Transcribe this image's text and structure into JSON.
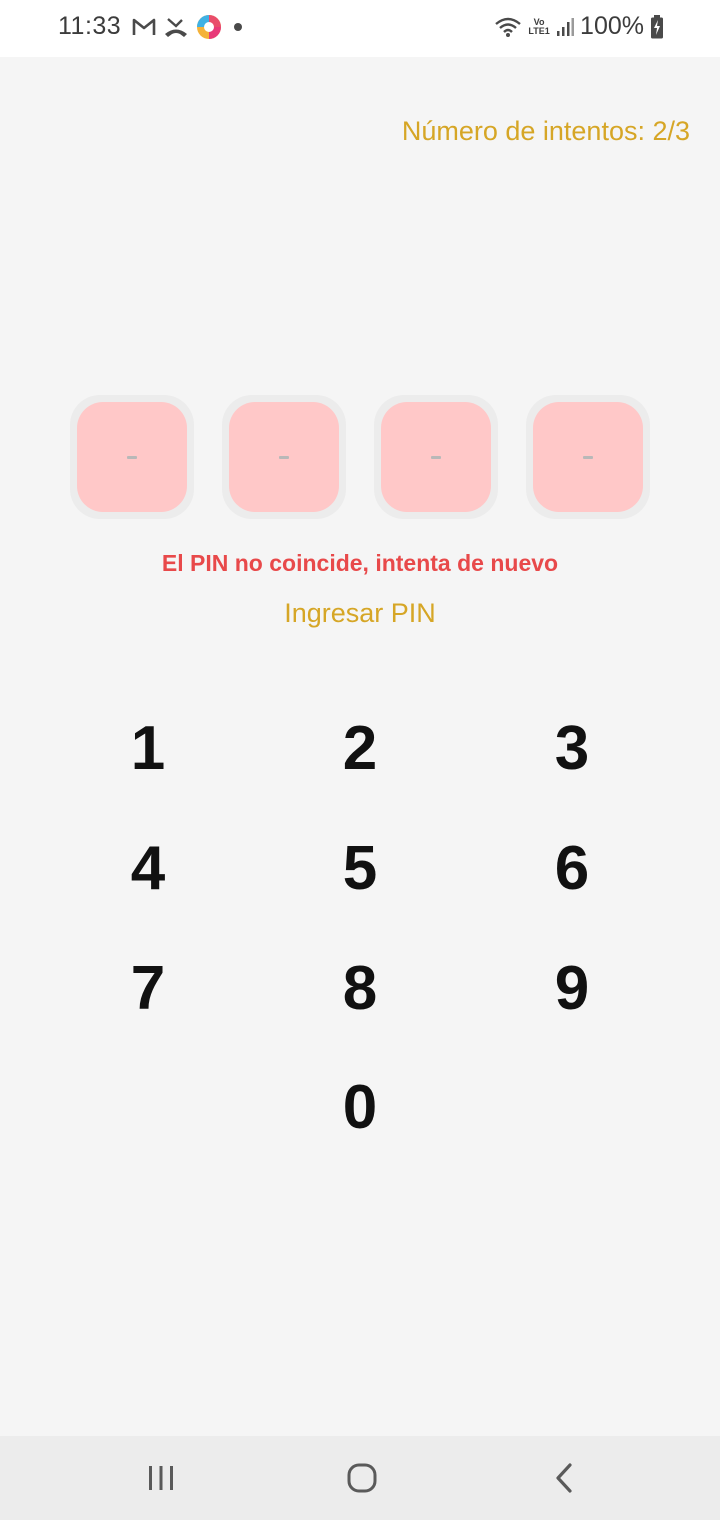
{
  "status_bar": {
    "time": "11:33",
    "battery": "100%",
    "network_label": "Vo LTE1",
    "icons": [
      "gmail-icon",
      "missed-call-icon",
      "app-icon",
      "notification-dot-icon",
      "wifi-icon",
      "lte-icon",
      "signal-icon",
      "battery-charging-icon"
    ]
  },
  "attempts": {
    "label": "Número de intentos: 2/3"
  },
  "pin": {
    "slots": [
      "-",
      "-",
      "-",
      "-"
    ]
  },
  "error_message": "El PIN no coincide, intenta de nuevo",
  "prompt": "Ingresar PIN",
  "keypad": {
    "keys": [
      "1",
      "2",
      "3",
      "4",
      "5",
      "6",
      "7",
      "8",
      "9",
      "0"
    ]
  },
  "nav": {
    "buttons": [
      "recents-icon",
      "home-icon",
      "back-icon"
    ]
  },
  "colors": {
    "accent": "#d6a626",
    "error": "#e8494a",
    "pin_box": "#ffc8c8"
  }
}
